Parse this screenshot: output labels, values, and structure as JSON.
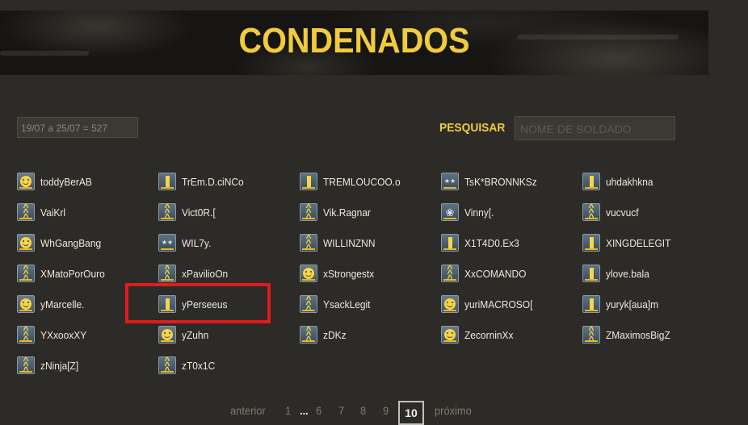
{
  "header": {
    "title": "CONDENADOS"
  },
  "week_field": {
    "value": "19/07 a 25/07 = 527"
  },
  "search": {
    "label": "PESQUISAR",
    "placeholder": "NOME DE SOLDADO"
  },
  "colors": {
    "accent": "#f1cb3f",
    "highlight": "#e3191f",
    "background": "#2d2b27"
  },
  "players": [
    {
      "name": "toddyBerAB",
      "rank": "smile-icon"
    },
    {
      "name": "TrEm.D.ciNCo",
      "rank": "bar-icon"
    },
    {
      "name": "TREMLOUCOO.o",
      "rank": "bar-icon"
    },
    {
      "name": "TsK*BRONNKSz",
      "rank": "stars-icon"
    },
    {
      "name": "uhdakhkna",
      "rank": "bar-icon"
    },
    {
      "name": "VaiKrl",
      "rank": "chevron-icon"
    },
    {
      "name": "Vict0R.[",
      "rank": "chevron-icon"
    },
    {
      "name": "Vik.Ragnar",
      "rank": "chevron-icon"
    },
    {
      "name": "Vinny[.",
      "rank": "leaf-icon"
    },
    {
      "name": "vucvucf",
      "rank": "chevron-icon"
    },
    {
      "name": "WhGangBang",
      "rank": "smile-icon"
    },
    {
      "name": "WIL7y.",
      "rank": "stars-icon"
    },
    {
      "name": "WILLINZNN",
      "rank": "chevron-icon"
    },
    {
      "name": "X1T4D0.Ex3",
      "rank": "bar-icon"
    },
    {
      "name": "XINGDELEGIT",
      "rank": "bar-icon"
    },
    {
      "name": "XMatoPorOuro",
      "rank": "chevron-icon"
    },
    {
      "name": "xPavilioOn",
      "rank": "chevron-icon"
    },
    {
      "name": "xStrongestx",
      "rank": "smile-icon"
    },
    {
      "name": "XxCOMANDO",
      "rank": "chevron-icon"
    },
    {
      "name": "ylove.bala",
      "rank": "bar-icon"
    },
    {
      "name": "yMarcelle.",
      "rank": "smile-icon"
    },
    {
      "name": "yPerseeus",
      "rank": "bar-icon"
    },
    {
      "name": "YsackLegit",
      "rank": "chevron-icon"
    },
    {
      "name": "yuriMACROSO[",
      "rank": "smile-icon"
    },
    {
      "name": "yuryk[aua]m",
      "rank": "bar-icon"
    },
    {
      "name": "YXxooxXY",
      "rank": "chevron-icon"
    },
    {
      "name": "yZuhn",
      "rank": "smile-icon"
    },
    {
      "name": "zDKz",
      "rank": "chevron-icon"
    },
    {
      "name": "ZecorninXx",
      "rank": "smile-icon"
    },
    {
      "name": "ZMaximosBigZ",
      "rank": "chevron-icon"
    },
    {
      "name": "zNinja[Z]",
      "rank": "chevron-icon"
    },
    {
      "name": "zT0x1C",
      "rank": "chevron-icon"
    }
  ],
  "pagination": {
    "prev": "anterior",
    "first": "1",
    "ellipsis": "...",
    "pages": [
      "6",
      "7",
      "8",
      "9"
    ],
    "current": "10",
    "next": "próximo"
  }
}
